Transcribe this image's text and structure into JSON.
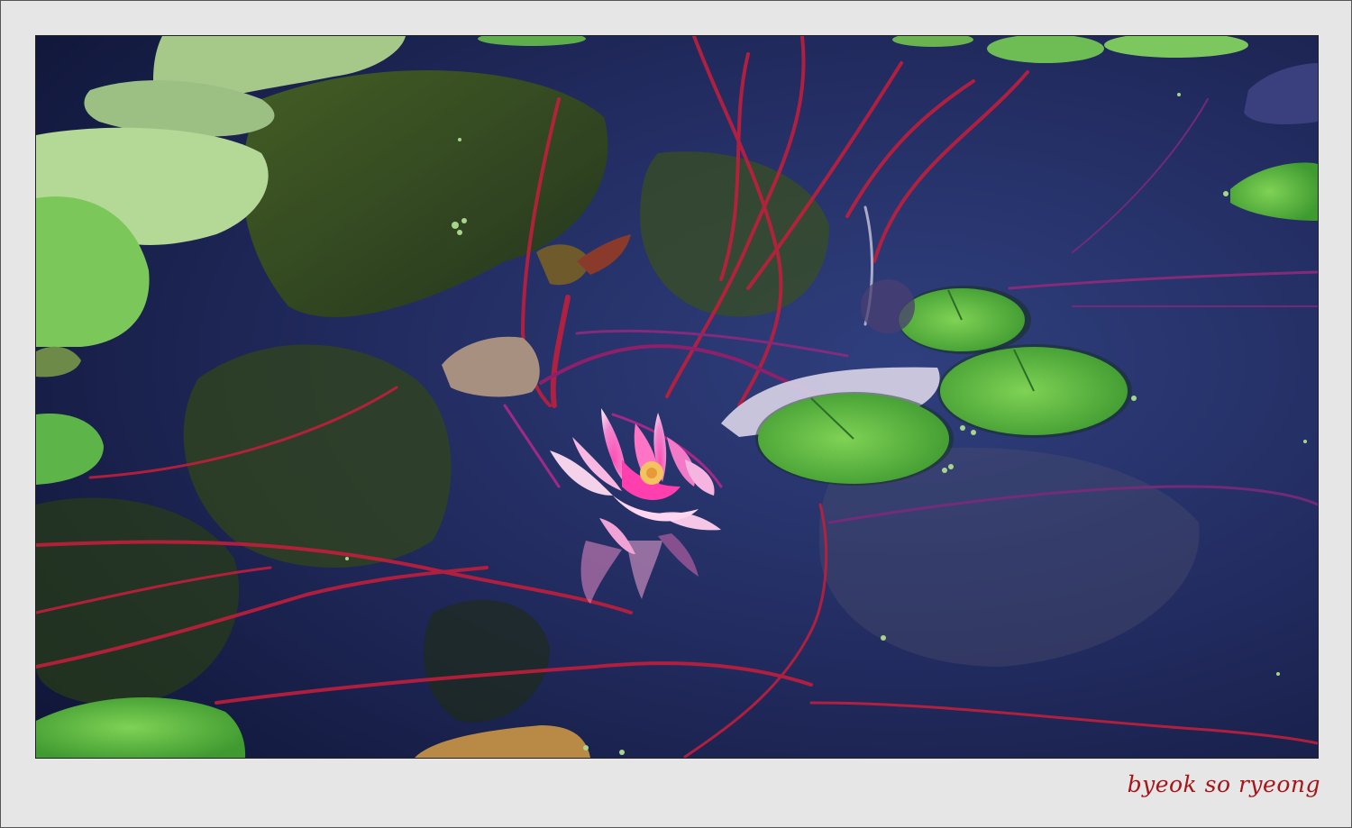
{
  "signature": "byeok so ryeong",
  "colors": {
    "frame": "#e6e6e6",
    "water": "#1c2447",
    "lily_pad": "#6cc04a",
    "stem": "#c01f3c",
    "flower": "#e860b6",
    "signature": "#a4161a"
  }
}
